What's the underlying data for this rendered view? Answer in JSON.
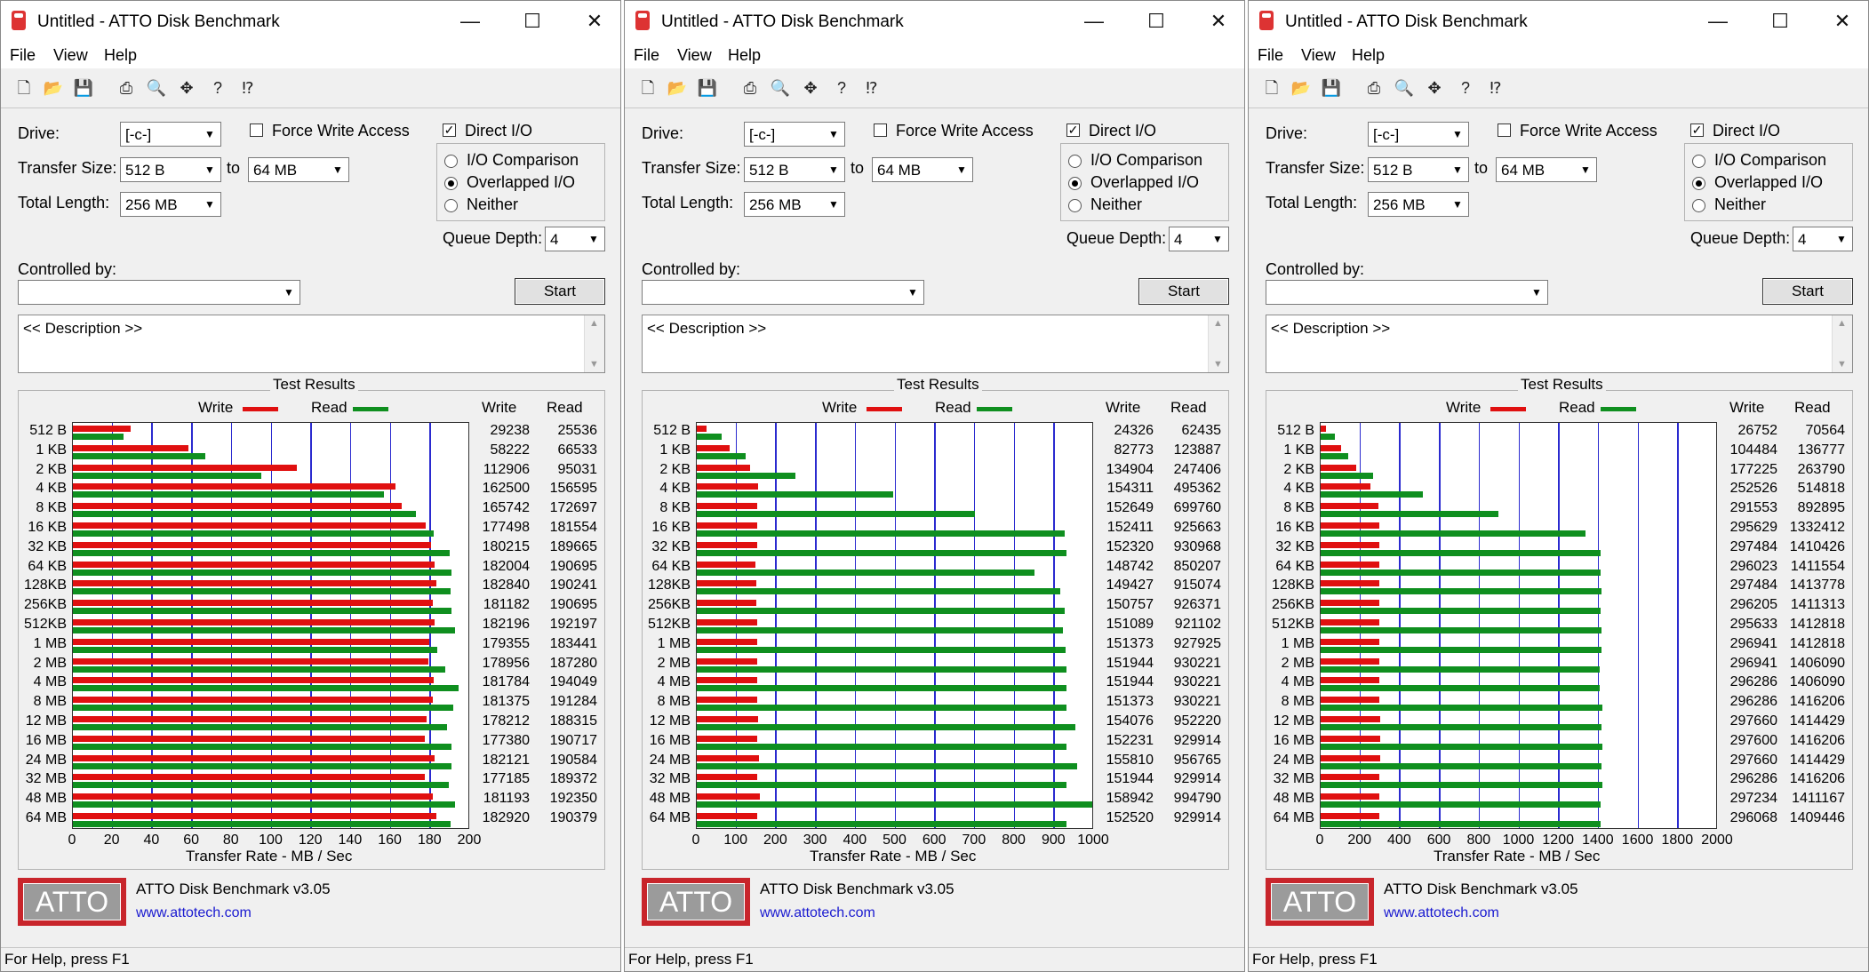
{
  "window_title": "Untitled - ATTO Disk Benchmark",
  "caption_buttons": [
    "—",
    "☐",
    "✕"
  ],
  "menu": [
    "File",
    "View",
    "Help"
  ],
  "toolbar_icons": [
    "new-icon",
    "open-icon",
    "save-icon",
    "print-icon",
    "print-preview-icon",
    "move-icon",
    "help-icon",
    "context-help-icon"
  ],
  "labels": {
    "drive": "Drive:",
    "transfer_size": "Transfer Size:",
    "to": "to",
    "total_length": "Total Length:",
    "force_write": "Force Write Access",
    "direct_io": "Direct I/O",
    "io_comparison": "I/O Comparison",
    "overlapped_io": "Overlapped I/O",
    "neither": "Neither",
    "queue_depth": "Queue Depth:",
    "controlled_by": "Controlled by:",
    "start": "Start",
    "description": "<< Description >>",
    "test_results": "Test Results",
    "write": "Write",
    "read": "Read",
    "xaxis": "Transfer Rate - MB / Sec",
    "product": "ATTO Disk Benchmark v3.05",
    "url": "www.attotech.com",
    "logo": "ATTO",
    "status": "For Help, press F1"
  },
  "settings": {
    "drive": "[-c-]",
    "transfer_from": "512 B",
    "transfer_to": "64 MB",
    "total_length": "256 MB",
    "queue_depth": "4",
    "controlled_by": "",
    "force_write": false,
    "direct_io": true,
    "mode": "overlapped"
  },
  "colors": {
    "write": "#e01010",
    "read": "#0f8f1f",
    "grid": "#2a2acf",
    "logo": "#c8252b"
  },
  "chart_data": [
    {
      "type": "bar",
      "categories": [
        "512 B",
        "1 KB",
        "2 KB",
        "4 KB",
        "8 KB",
        "16 KB",
        "32 KB",
        "64 KB",
        "128KB",
        "256KB",
        "512KB",
        "1 MB",
        "2 MB",
        "4 MB",
        "8 MB",
        "12 MB",
        "16 MB",
        "24 MB",
        "32 MB",
        "48 MB",
        "64 MB"
      ],
      "xlim": [
        0,
        200
      ],
      "xticks": [
        "0",
        "20",
        "40",
        "60",
        "80",
        "100",
        "120",
        "140",
        "160",
        "180",
        "200"
      ],
      "series": [
        {
          "name": "Write",
          "values": [
            29238,
            58222,
            112906,
            162500,
            165742,
            177498,
            180215,
            182004,
            182840,
            181182,
            182196,
            179355,
            178956,
            181784,
            181375,
            178212,
            177380,
            182121,
            177185,
            181193,
            182920
          ]
        },
        {
          "name": "Read",
          "values": [
            25536,
            66533,
            95031,
            156595,
            172697,
            181554,
            189665,
            190695,
            190241,
            190695,
            192197,
            183441,
            187280,
            194049,
            191284,
            188315,
            190717,
            190584,
            189372,
            192350,
            190379
          ]
        }
      ]
    },
    {
      "type": "bar",
      "categories": [
        "512 B",
        "1 KB",
        "2 KB",
        "4 KB",
        "8 KB",
        "16 KB",
        "32 KB",
        "64 KB",
        "128KB",
        "256KB",
        "512KB",
        "1 MB",
        "2 MB",
        "4 MB",
        "8 MB",
        "12 MB",
        "16 MB",
        "24 MB",
        "32 MB",
        "48 MB",
        "64 MB"
      ],
      "xlim": [
        0,
        1000
      ],
      "xticks": [
        "0",
        "100",
        "200",
        "300",
        "400",
        "500",
        "600",
        "700",
        "800",
        "900",
        "1000"
      ],
      "series": [
        {
          "name": "Write",
          "values": [
            24326,
            82773,
            134904,
            154311,
            152649,
            152411,
            152320,
            148742,
            149427,
            150757,
            151089,
            151373,
            151944,
            151944,
            151373,
            154076,
            152231,
            155810,
            151944,
            158942,
            152520
          ]
        },
        {
          "name": "Read",
          "values": [
            62435,
            123887,
            247406,
            495362,
            699760,
            925663,
            930968,
            850207,
            915074,
            926371,
            921102,
            927925,
            930221,
            930221,
            930221,
            952220,
            929914,
            956765,
            929914,
            994790,
            929914
          ]
        }
      ]
    },
    {
      "type": "bar",
      "categories": [
        "512 B",
        "1 KB",
        "2 KB",
        "4 KB",
        "8 KB",
        "16 KB",
        "32 KB",
        "64 KB",
        "128KB",
        "256KB",
        "512KB",
        "1 MB",
        "2 MB",
        "4 MB",
        "8 MB",
        "12 MB",
        "16 MB",
        "24 MB",
        "32 MB",
        "48 MB",
        "64 MB"
      ],
      "xlim": [
        0,
        2000
      ],
      "xticks": [
        "0",
        "200",
        "400",
        "600",
        "800",
        "1000",
        "1200",
        "1400",
        "1600",
        "1800",
        "2000"
      ],
      "series": [
        {
          "name": "Write",
          "values": [
            26752,
            104484,
            177225,
            252526,
            291553,
            295629,
            297484,
            296023,
            297484,
            296205,
            295633,
            296941,
            296941,
            296286,
            296286,
            297660,
            297600,
            297660,
            296286,
            297234,
            296068
          ]
        },
        {
          "name": "Read",
          "values": [
            70564,
            136777,
            263790,
            514818,
            892895,
            1332412,
            1410426,
            1411554,
            1413778,
            1411313,
            1412818,
            1412818,
            1406090,
            1406090,
            1416206,
            1414429,
            1416206,
            1414429,
            1416206,
            1411167,
            1409446
          ]
        }
      ]
    }
  ]
}
